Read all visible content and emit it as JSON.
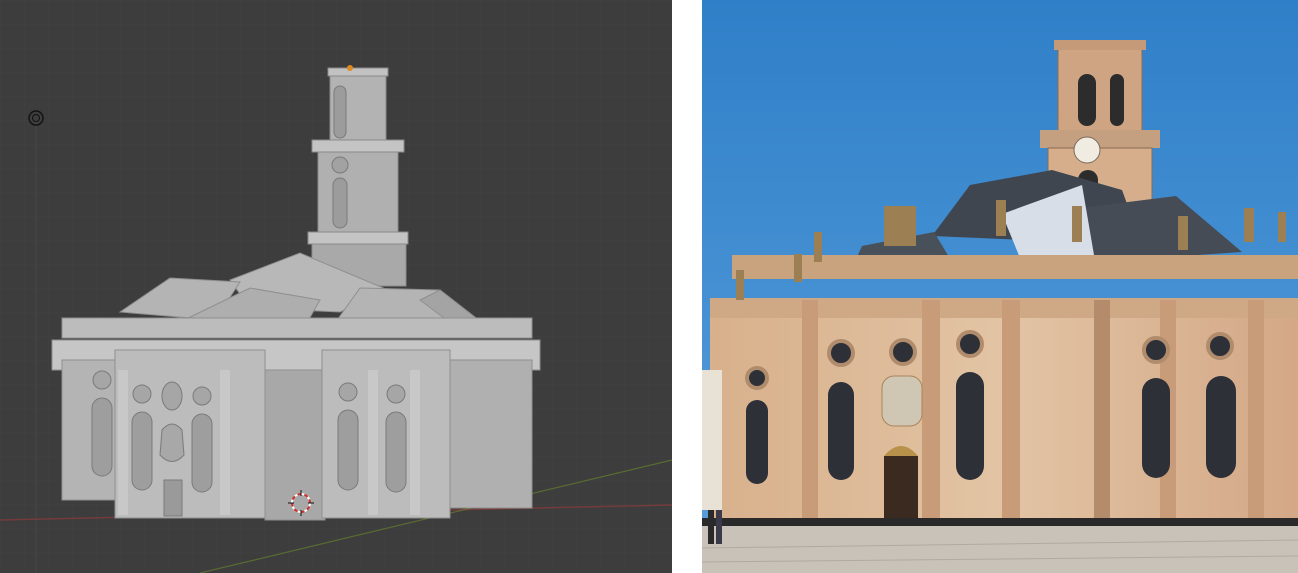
{
  "viewport": {
    "background": "#3d3d3d",
    "grid_color": "#434343",
    "axis_x_color": "#8a3b3b",
    "axis_y_color": "#6a8a2a",
    "model_color": "#a8a8a8",
    "icons": [
      "light-icon",
      "3d-cursor-icon",
      "origin-dot-icon"
    ]
  },
  "photo": {
    "sky_color": "#3a88cf",
    "facade_color": "#d9b794",
    "roof_color": "#3f4650",
    "plaza_color": "#c8c2b8"
  }
}
